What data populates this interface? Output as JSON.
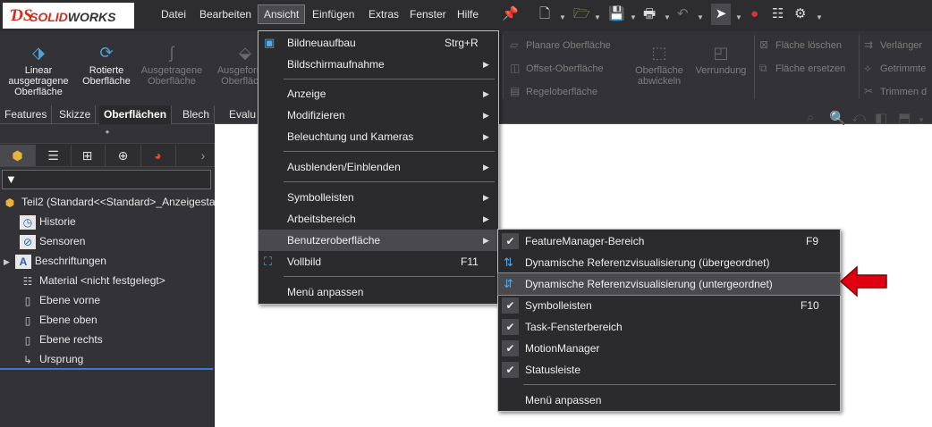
{
  "app": {
    "logo_mark": "ƊS",
    "logo_solid": "SOLID",
    "logo_works": "WORKS"
  },
  "menubar": [
    {
      "label": "Datei"
    },
    {
      "label": "Bearbeiten"
    },
    {
      "label": "Ansicht"
    },
    {
      "label": "Einfügen"
    },
    {
      "label": "Extras"
    },
    {
      "label": "Fenster"
    },
    {
      "label": "Hilfe"
    }
  ],
  "ribbon": {
    "buttons": [
      {
        "label": "Linear ausgetragene Oberfläche",
        "icon": "swept-surface-icon"
      },
      {
        "label": "Rotierte Oberfläche",
        "icon": "revolved-surface-icon"
      },
      {
        "label": "Ausgetragene Oberfläche",
        "icon": "swept-icon"
      },
      {
        "label": "Ausgeformte Oberfläche",
        "icon": "loft-icon"
      },
      {
        "label": "Oberfläche abwickeln",
        "icon": "flatten-icon"
      },
      {
        "label": "Verrundung",
        "icon": "fillet-icon"
      }
    ],
    "rows": [
      {
        "label": "Planare Oberfläche"
      },
      {
        "label": "Offset-Oberfläche"
      },
      {
        "label": "Regeloberfläche"
      },
      {
        "label": "Fläche löschen"
      },
      {
        "label": "Fläche ersetzen"
      },
      {
        "label": "Verlänger"
      },
      {
        "label": "Getrimmte"
      },
      {
        "label": "Trimmen d"
      }
    ]
  },
  "tabs": [
    {
      "label": "Features"
    },
    {
      "label": "Skizze"
    },
    {
      "label": "Oberflächen"
    },
    {
      "label": "Blech"
    },
    {
      "label": "Evalu"
    }
  ],
  "panel": {
    "filter_glyph": "▼",
    "tree": [
      {
        "label": "Teil2  (Standard<<Standard>_Anzeigesta",
        "icon": "part-icon"
      },
      {
        "label": "Historie",
        "icon": "history-icon"
      },
      {
        "label": "Sensoren",
        "icon": "sensor-icon"
      },
      {
        "label": "Beschriftungen",
        "icon": "annotations-icon"
      },
      {
        "label": "Material <nicht festgelegt>",
        "icon": "material-icon"
      },
      {
        "label": "Ebene vorne",
        "icon": "plane-icon"
      },
      {
        "label": "Ebene oben",
        "icon": "plane-icon"
      },
      {
        "label": "Ebene rechts",
        "icon": "plane-icon"
      },
      {
        "label": "Ursprung",
        "icon": "origin-icon"
      }
    ]
  },
  "view_menu": {
    "items": [
      {
        "label": "Bildneuaufbau",
        "shortcut": "Strg+R",
        "icon": "rebuild-icon"
      },
      {
        "label": "Bildschirmaufnahme",
        "shortcut": "▶"
      },
      {
        "label": "Anzeige",
        "shortcut": "▶"
      },
      {
        "label": "Modifizieren",
        "shortcut": "▶"
      },
      {
        "label": "Beleuchtung und Kameras",
        "shortcut": "▶"
      },
      {
        "label": "Ausblenden/Einblenden",
        "shortcut": "▶"
      },
      {
        "label": "Symbolleisten",
        "shortcut": "▶"
      },
      {
        "label": "Arbeitsbereich",
        "shortcut": "▶"
      },
      {
        "label": "Benutzeroberfläche",
        "shortcut": "▶"
      },
      {
        "label": "Vollbild",
        "shortcut": "F11",
        "icon": "fullscreen-icon"
      },
      {
        "label": "Menü anpassen",
        "shortcut": ""
      }
    ]
  },
  "ui_submenu": {
    "items": [
      {
        "label": "FeatureManager-Bereich",
        "shortcut": "F9",
        "checked": true
      },
      {
        "label": "Dynamische Referenzvisualisierung (übergeordnet)",
        "shortcut": "",
        "icon": "ref-parent-icon"
      },
      {
        "label": "Dynamische Referenzvisualisierung (untergeordnet)",
        "shortcut": "",
        "icon": "ref-child-icon"
      },
      {
        "label": "Symbolleisten",
        "shortcut": "F10",
        "checked": true
      },
      {
        "label": "Task-Fensterbereich",
        "shortcut": "",
        "checked": true
      },
      {
        "label": "MotionManager",
        "shortcut": "",
        "checked": true
      },
      {
        "label": "Statusleiste",
        "shortcut": "",
        "checked": true
      },
      {
        "label": "Menü anpassen",
        "shortcut": ""
      }
    ]
  },
  "colors": {
    "accent_blue": "#3d7ad6",
    "arrow_red": "#e0000f",
    "menu_bg": "#2b2b2e"
  }
}
